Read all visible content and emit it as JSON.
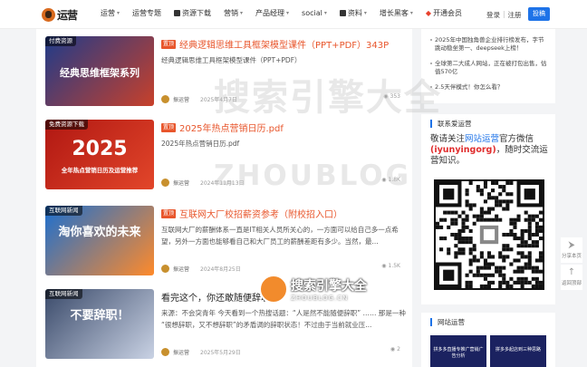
{
  "header": {
    "logo_text": "运营",
    "nav": [
      {
        "label": "运营",
        "caret": true
      },
      {
        "label": "运营专题",
        "caret": false
      },
      {
        "label": "资源下载",
        "caret": false,
        "icon": true
      },
      {
        "label": "营销",
        "caret": true
      },
      {
        "label": "产品经理",
        "caret": true
      },
      {
        "label": "social",
        "caret": true
      },
      {
        "label": "资料",
        "caret": true,
        "icon": true
      },
      {
        "label": "增长黑客",
        "caret": true
      },
      {
        "label": "开通会员",
        "caret": false,
        "diamond": true
      }
    ],
    "login": "登录",
    "separator": "|",
    "register": "注册",
    "submit": "投稿"
  },
  "posts": [
    {
      "thumb_tag": "付费资源",
      "thumb_text": "经典思维框架系列",
      "thumb_colors": [
        "#1f3b8a",
        "#c8402a"
      ],
      "badge": "置顶",
      "title": "经典逻辑思维工具框架模型课件（PPT+PDF）343P",
      "desc": "经典逻辑思维工具框架模型课件（PPT+PDF）",
      "author": "振运营",
      "date": "2025年4月7日",
      "views": "353"
    },
    {
      "thumb_tag": "免费资源下载",
      "thumb_text": "2025",
      "thumb_sub": "全年热点营销日历及运营推荐",
      "thumb_colors": [
        "#b01712",
        "#e2462a"
      ],
      "badge": "置顶",
      "title": "2025年热点营销日历.pdf",
      "desc": "2025年热点营销日历.pdf",
      "author": "振运营",
      "date": "2024年11月13日",
      "views": "1.8K"
    },
    {
      "thumb_tag": "互联网新闻",
      "thumb_text": "淘你喜欢的未来",
      "thumb_colors": [
        "#1a6fd1",
        "#ff8a2a"
      ],
      "badge": "置顶",
      "title": "互联网大厂校招薪资参考（附校招入口）",
      "desc": "互联网大厂的薪酬体系一直是IT相关人员所关心的，一方面可以给自己多一点希望，另外一方面也能够看自己和大厂员工的薪酬差距有多少。当然，最...",
      "author": "振运营",
      "date": "2024年8月25日",
      "views": "1.5K"
    },
    {
      "thumb_tag": "互联网新闻",
      "thumb_text": "不要辞职！",
      "thumb_colors": [
        "#3a4a6a",
        "#c9d2e4"
      ],
      "badge": "",
      "title": "看完这个，你还敢随便辞职吗？",
      "desc": "来源：不会突青年 今天看到一个热搜话题：“人是然不能随便辞职” …… 那是一种 “很想辞职，又不想辞职”的矛盾调的辞职状态！不过由于当前就业压...",
      "author": "振运营",
      "date": "2025年5月29日",
      "views": "2"
    }
  ],
  "sidebar": {
    "news": [
      "2025年中国独角兽企业排行榜发布，字节跳动稳坐第一、deepseek上榜！",
      "全球第二大成人网站，正在被打包出售，估值570亿",
      "2.5天伴模式！你怎么看？"
    ],
    "follow_heading": "联系爱运营",
    "follow_parts": {
      "p1": "敬请关注",
      "brand": "网站运营",
      "p2": "官方微信",
      "wechat": "(iyunyingorg)",
      "p3": "，随时交流运营知识。"
    },
    "ops_heading": "网站运营",
    "mini_cards": [
      "拼多多直播专推广营销广告分析",
      "拼多多起店到三种思路"
    ]
  },
  "tools": {
    "share_label": "分享本页",
    "top_label": "返回顶部"
  },
  "watermark": {
    "cn": "搜索引擎大全",
    "en": "ZHOUBLOG",
    "badge_cn": "搜索引擎大全",
    "badge_en": "ZHOUBLOG.CN"
  },
  "colors": {
    "accent": "#1e73e8",
    "title_red": "#e8562c",
    "badge_red": "#e8562c"
  }
}
